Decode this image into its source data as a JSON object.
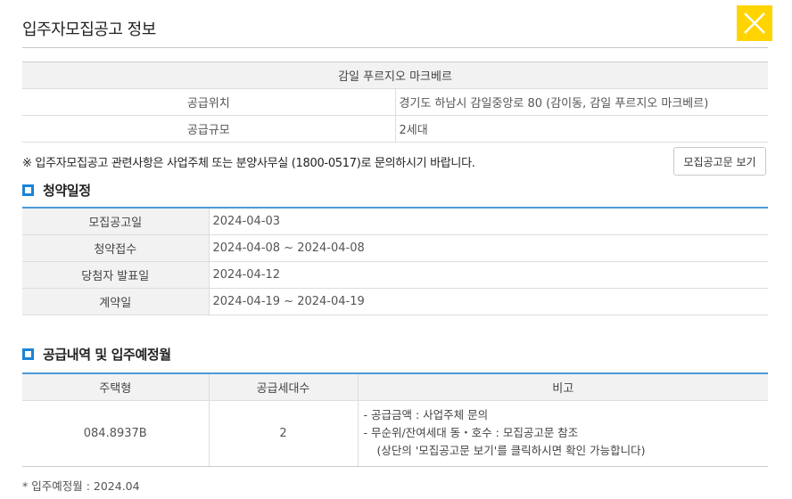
{
  "header": {
    "title": "입주자모집공고 정보",
    "close_icon": "close-icon",
    "accent_color": "#ffd400"
  },
  "info": {
    "complex_name": "감일 푸르지오 마크베르",
    "rows": [
      {
        "label": "공급위치",
        "value": "경기도 하남시 감일중앙로 80 (감이동, 감일 푸르지오 마크베르)"
      },
      {
        "label": "공급규모",
        "value": "2세대"
      }
    ]
  },
  "notice": {
    "text": "※ 입주자모집공고 관련사항은 사업주체 또는 분양사무실 (1800-0517)로 문의하시기 바랍니다.",
    "button_label": "모집공고문 보기"
  },
  "schedule": {
    "title": "청약일정",
    "rows": [
      {
        "label": "모집공고일",
        "value": "2024-04-03"
      },
      {
        "label": "청약접수",
        "value": "2024-04-08 ~ 2024-04-08"
      },
      {
        "label": "당첨자 발표일",
        "value": "2024-04-12"
      },
      {
        "label": "계약일",
        "value": "2024-04-19 ~ 2024-04-19"
      }
    ]
  },
  "supply": {
    "title": "공급내역 및 입주예정월",
    "headers": [
      "주택형",
      "공급세대수",
      "비고"
    ],
    "rows": [
      {
        "type": "084.8937B",
        "units": "2",
        "notes": [
          "-   공급금액 : 사업주체 문의",
          "-   무순위/잔여세대 동・호수 : 모집공고문 참조",
          "(상단의 '모집공고문 보기'를 클릭하시면 확인 가능합니다)"
        ]
      }
    ],
    "footnote": "* 입주예정월 : 2024.04"
  },
  "colors": {
    "section_accent": "#1a83d8",
    "table_top_border": "#4a9ad8"
  }
}
